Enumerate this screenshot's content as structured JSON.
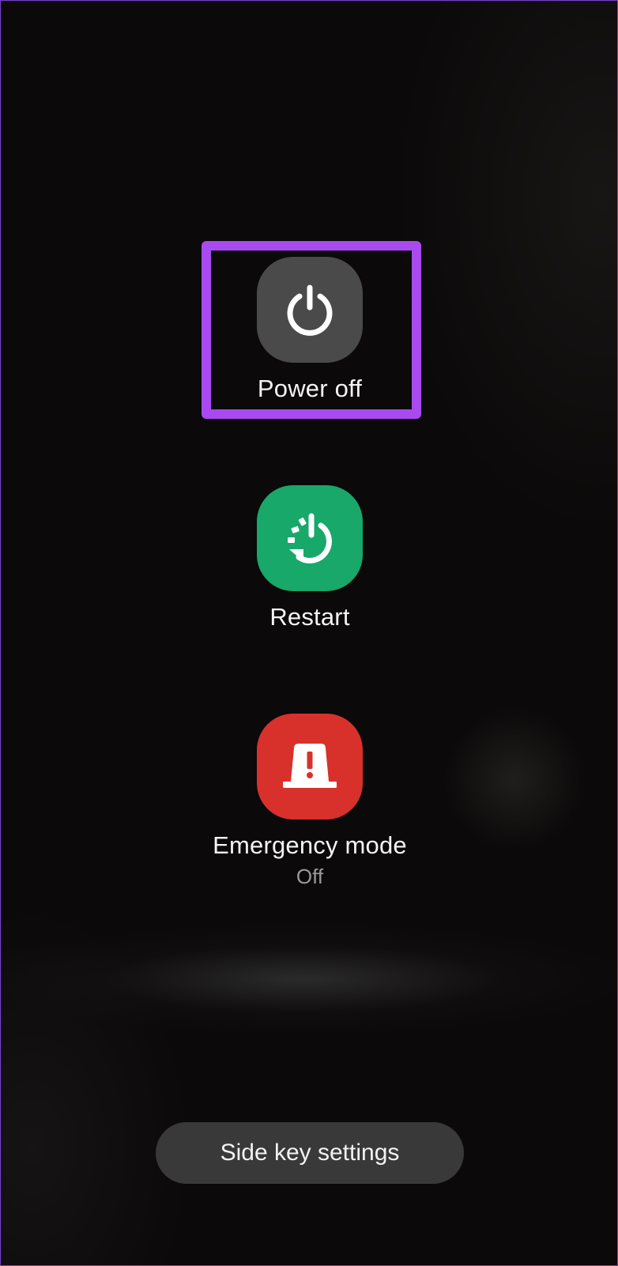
{
  "power_menu": {
    "power_off": {
      "label": "Power off",
      "icon": "power-icon",
      "color": "#4a4a4a"
    },
    "restart": {
      "label": "Restart",
      "icon": "restart-icon",
      "color": "#17a86a"
    },
    "emergency": {
      "label": "Emergency mode",
      "status": "Off",
      "icon": "emergency-siren-icon",
      "color": "#d8312c"
    }
  },
  "side_key": {
    "label": "Side key settings"
  },
  "highlight": {
    "target": "power-off-button",
    "color": "#a94af0"
  }
}
